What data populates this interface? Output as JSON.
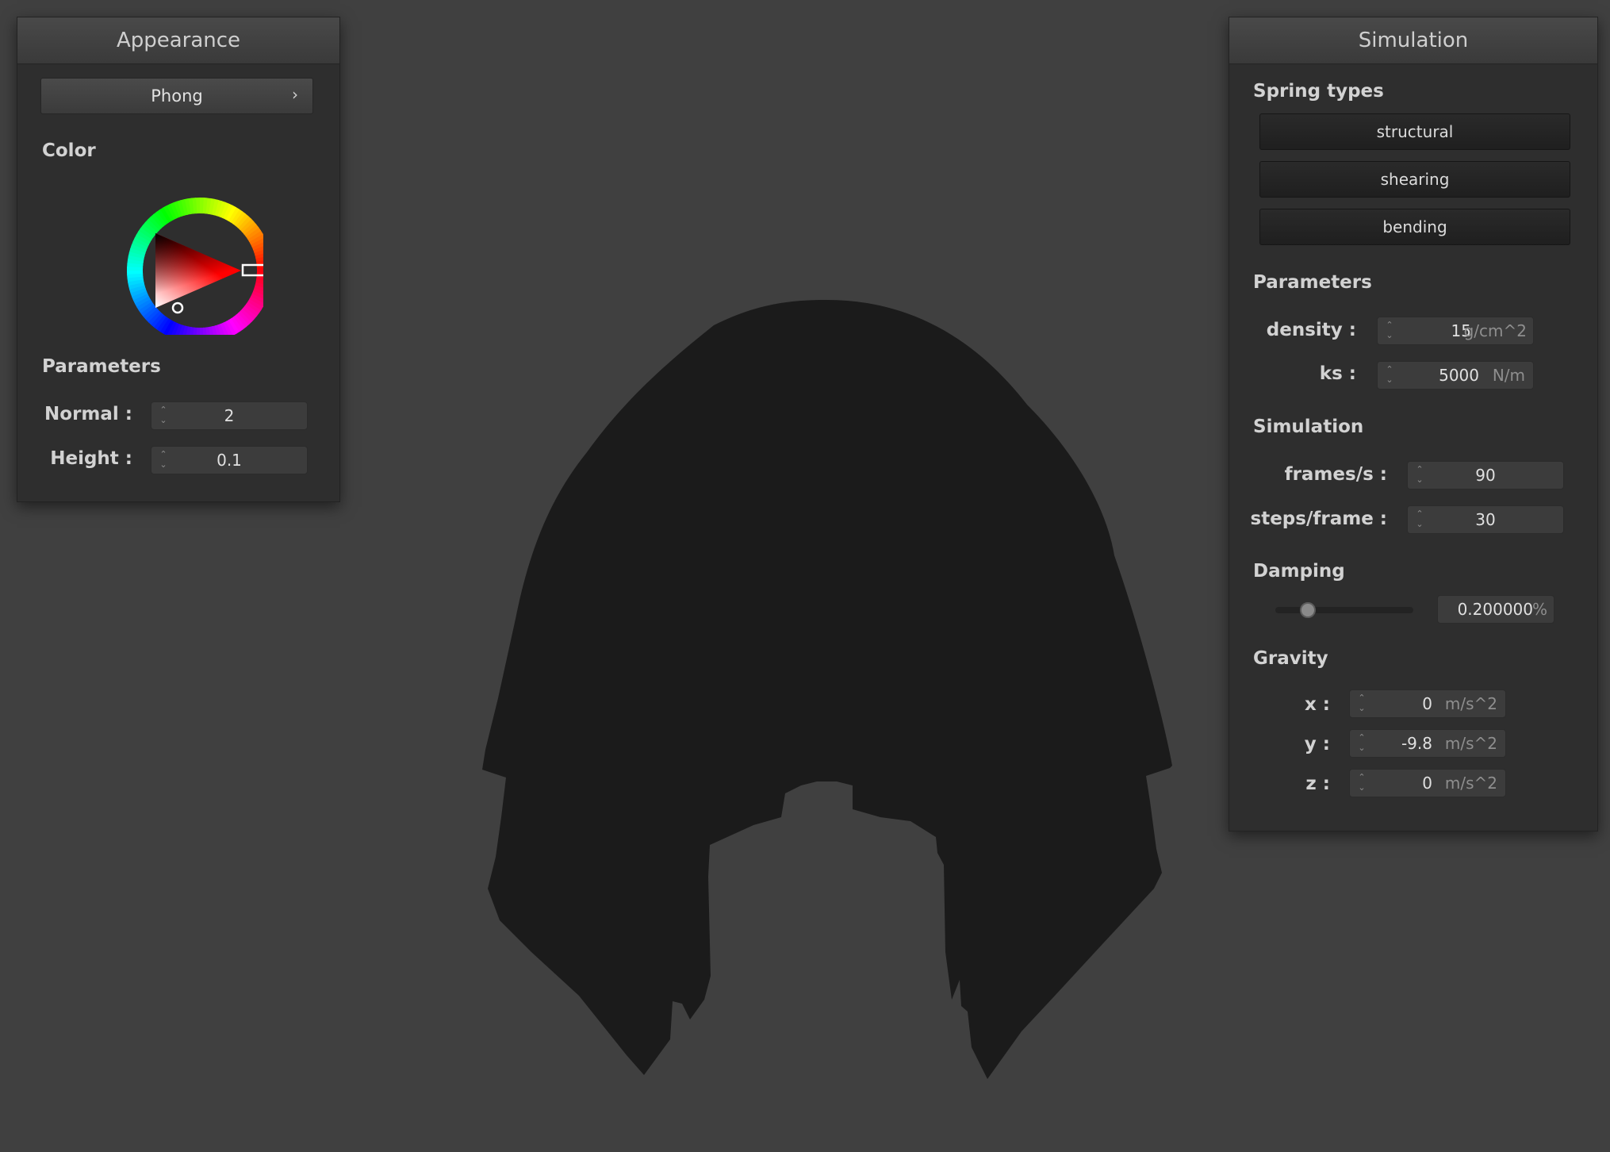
{
  "appearance": {
    "title": "Appearance",
    "shader": {
      "value": "Phong",
      "arrow_icon": "chevron-right-icon"
    },
    "color_label": "Color",
    "color": {
      "hue_hex": "#ff0000",
      "selected_hex": "#e7e0e0"
    },
    "parameters_label": "Parameters",
    "normal": {
      "label": "Normal :",
      "value": "2"
    },
    "height": {
      "label": "Height :",
      "value": "0.1"
    }
  },
  "simulation": {
    "title": "Simulation",
    "spring_types_label": "Spring types",
    "springs": [
      "structural",
      "shearing",
      "bending"
    ],
    "parameters_label": "Parameters",
    "density": {
      "label": "density :",
      "value": "15",
      "unit": "g/cm^2"
    },
    "ks": {
      "label": "ks :",
      "value": "5000",
      "unit": "N/m"
    },
    "simulation_label": "Simulation",
    "fps": {
      "label": "frames/s :",
      "value": "90"
    },
    "steps": {
      "label": "steps/frame :",
      "value": "30"
    },
    "damping_label": "Damping",
    "damping": {
      "value": "0.200000",
      "unit": "%",
      "slider_fraction": 0.2
    },
    "gravity_label": "Gravity",
    "gravity": {
      "x": {
        "label": "x :",
        "value": "0",
        "unit": "m/s^2"
      },
      "y": {
        "label": "y :",
        "value": "-9.8",
        "unit": "m/s^2"
      },
      "z": {
        "label": "z :",
        "value": "0",
        "unit": "m/s^2"
      }
    }
  },
  "colors": {
    "background": "#404040",
    "cloth": "#1b1b1b",
    "panel": "#2e2e2e"
  }
}
